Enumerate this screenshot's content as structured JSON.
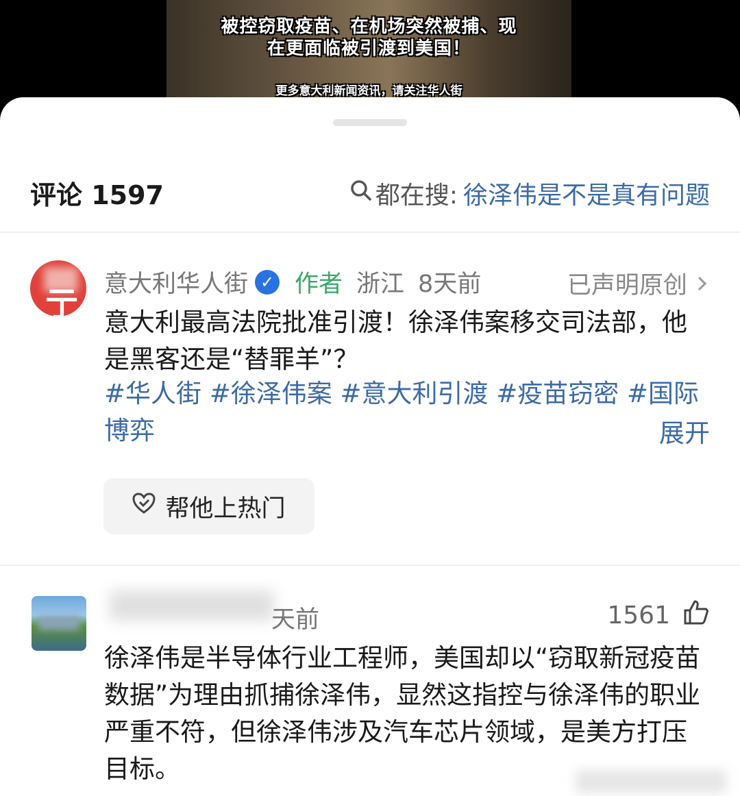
{
  "video": {
    "caption_line1": "被控窃取疫苗、在机场突然被捕、现",
    "caption_line2": "在更面临被引渡到美国！",
    "caption_footer": "更多意大利新闻资讯，请关注华人街"
  },
  "comments_header": {
    "count_label": "评论 1597",
    "hot_search_prefix": "都在搜:",
    "hot_search_query": "徐泽伟是不是真有问题"
  },
  "post": {
    "author_name": "意大利华人街",
    "author_badge": "作者",
    "location": "浙江",
    "time": "8天前",
    "original_label": "已声明原创",
    "text": "意大利最高法院批准引渡！徐泽伟案移交司法部，他是黑客还是“替罪羊”？",
    "tags": "#华人街 #徐泽伟案 #意大利引渡 #疫苗窃密 #国际博弈",
    "expand_label": "展开",
    "boost_label": "帮他上热门"
  },
  "comment": {
    "meta": "天前",
    "like_count": "1561",
    "text": "徐泽伟是半导体行业工程师，美国却以“窃取新冠疫苗数据”为理由抓捕徐泽伟，显然这指控与徐泽伟的职业严重不符，但徐泽伟涉及汽车芯片领域，是美方打压目标。"
  },
  "colors": {
    "link_blue": "#3b6aa8",
    "author_green": "#3aa86a",
    "verify_blue": "#2a72e0",
    "avatar_red": "#e0413a"
  }
}
